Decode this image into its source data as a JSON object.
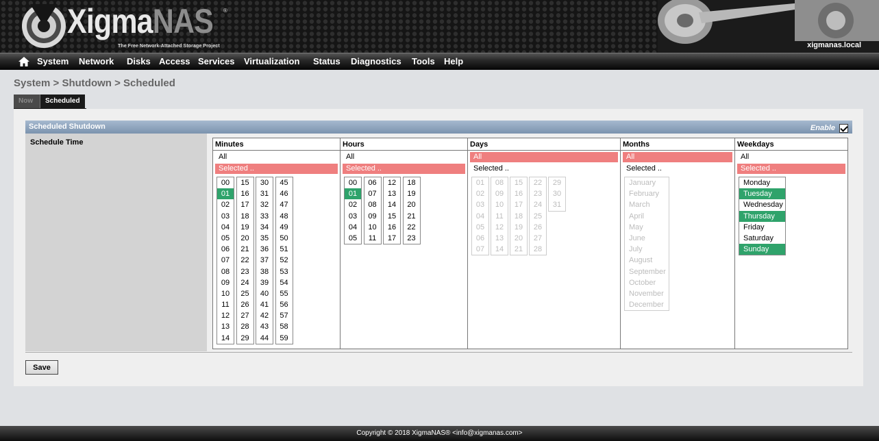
{
  "header": {
    "logo_main": "Xigma",
    "logo_accent": "NAS",
    "logo_reg": "®",
    "logo_tagline": "The Free Network-Attached Storage Project",
    "hostname": "xigmanas.local"
  },
  "nav": {
    "home_icon": "home-icon",
    "items": [
      "System",
      "Network",
      "Disks",
      "Access",
      "Services",
      "Virtualization",
      "Status",
      "Diagnostics",
      "Tools",
      "Help"
    ]
  },
  "breadcrumb": "System > Shutdown > Scheduled",
  "tabs": {
    "now": "Now",
    "scheduled": "Scheduled"
  },
  "section": {
    "title": "Scheduled Shutdown",
    "enable_label": "Enable",
    "enable_checked": true
  },
  "schedule": {
    "label": "Schedule Time",
    "minutes": {
      "header": "Minutes",
      "all": "All",
      "selected": "Selected ..",
      "mode": "selected",
      "columns": [
        [
          "00",
          "01",
          "02",
          "03",
          "04",
          "05",
          "06",
          "07",
          "08",
          "09",
          "10",
          "11",
          "12",
          "13",
          "14"
        ],
        [
          "15",
          "16",
          "17",
          "18",
          "19",
          "20",
          "21",
          "22",
          "23",
          "24",
          "25",
          "26",
          "27",
          "28",
          "29"
        ],
        [
          "30",
          "31",
          "32",
          "33",
          "34",
          "35",
          "36",
          "37",
          "38",
          "39",
          "40",
          "41",
          "42",
          "43",
          "44"
        ],
        [
          "45",
          "46",
          "47",
          "48",
          "49",
          "50",
          "51",
          "52",
          "53",
          "54",
          "55",
          "56",
          "57",
          "58",
          "59"
        ]
      ],
      "chosen": [
        "01"
      ]
    },
    "hours": {
      "header": "Hours",
      "all": "All",
      "selected": "Selected ..",
      "mode": "selected",
      "columns": [
        [
          "00",
          "01",
          "02",
          "03",
          "04",
          "05"
        ],
        [
          "06",
          "07",
          "08",
          "09",
          "10",
          "11"
        ],
        [
          "12",
          "13",
          "14",
          "15",
          "16",
          "17"
        ],
        [
          "18",
          "19",
          "20",
          "21",
          "22",
          "23"
        ]
      ],
      "chosen": [
        "01"
      ]
    },
    "days": {
      "header": "Days",
      "all": "All",
      "selected": "Selected ..",
      "mode": "all",
      "columns": [
        [
          "01",
          "02",
          "03",
          "04",
          "05",
          "06",
          "07"
        ],
        [
          "08",
          "09",
          "10",
          "11",
          "12",
          "13",
          "14"
        ],
        [
          "15",
          "16",
          "17",
          "18",
          "19",
          "20",
          "21"
        ],
        [
          "22",
          "23",
          "24",
          "25",
          "26",
          "27",
          "28"
        ],
        [
          "29",
          "30",
          "31"
        ]
      ],
      "chosen": []
    },
    "months": {
      "header": "Months",
      "all": "All",
      "selected": "Selected ..",
      "mode": "all",
      "items": [
        "January",
        "February",
        "March",
        "April",
        "May",
        "June",
        "July",
        "August",
        "September",
        "October",
        "November",
        "December"
      ],
      "chosen": []
    },
    "weekdays": {
      "header": "Weekdays",
      "all": "All",
      "selected": "Selected ..",
      "mode": "selected",
      "items": [
        "Monday",
        "Tuesday",
        "Wednesday",
        "Thursday",
        "Friday",
        "Saturday",
        "Sunday"
      ],
      "chosen": [
        "Tuesday",
        "Thursday",
        "Sunday"
      ]
    }
  },
  "save_label": "Save",
  "footer": "Copyright © 2018 XigmaNAS® <info@xigmanas.com>",
  "colors": {
    "selected_item": "#2fa36b",
    "selected_mode": "#ef7f7f",
    "section_header": "#8aa0ba"
  }
}
